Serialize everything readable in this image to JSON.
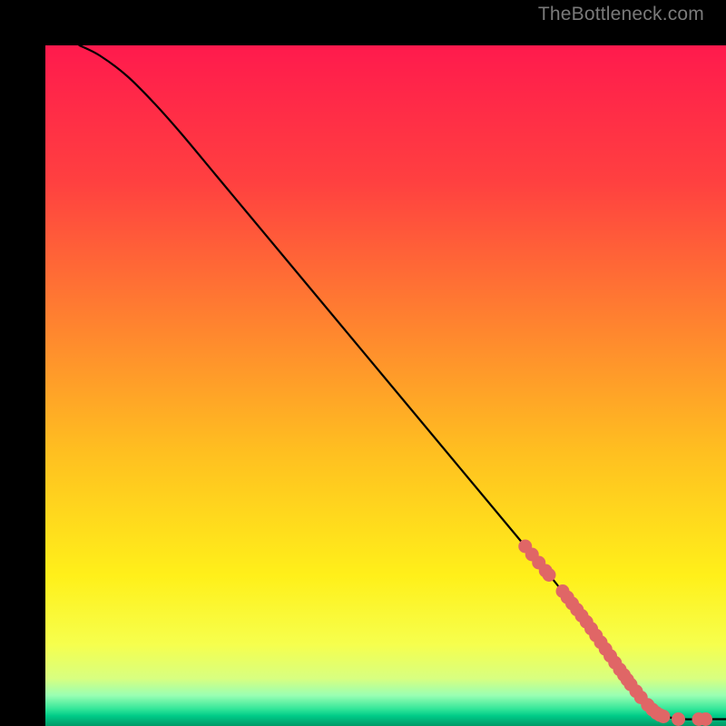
{
  "watermark": "TheBottleneck.com",
  "chart_data": {
    "type": "line",
    "title": "",
    "xlabel": "",
    "ylabel": "",
    "xlim": [
      0,
      100
    ],
    "ylim": [
      0,
      100
    ],
    "grid": false,
    "curve": {
      "x": [
        5,
        8,
        12,
        16,
        20,
        25,
        30,
        35,
        40,
        45,
        50,
        55,
        60,
        65,
        70,
        75,
        78,
        80,
        82,
        84,
        86,
        88,
        90,
        92,
        94,
        96,
        98,
        100
      ],
      "y": [
        100,
        98.5,
        95.5,
        91.5,
        87,
        81,
        75,
        69,
        63,
        57,
        51,
        45,
        39,
        33,
        27,
        21,
        17,
        14,
        11,
        8,
        5.5,
        3.5,
        2,
        1.2,
        1,
        1,
        1,
        1
      ]
    },
    "highlight_points": {
      "color": "#e06666",
      "x": [
        70.5,
        71.5,
        72.5,
        73.5,
        74.0,
        76.0,
        76.7,
        77.4,
        78.1,
        78.8,
        79.5,
        80.2,
        80.9,
        81.6,
        82.3,
        83.0,
        83.7,
        84.4,
        85.0,
        85.5,
        86.0,
        86.8,
        87.5,
        88.5,
        89.2,
        89.8,
        90.3,
        90.8,
        93.0,
        96.0,
        97.0
      ],
      "y": [
        26.4,
        25.2,
        24.0,
        22.8,
        22.2,
        19.8,
        18.9,
        18.0,
        17.1,
        16.2,
        15.3,
        14.3,
        13.3,
        12.3,
        11.3,
        10.3,
        9.3,
        8.3,
        7.5,
        6.8,
        6.1,
        5.1,
        4.2,
        3.1,
        2.4,
        1.9,
        1.6,
        1.4,
        1.0,
        1.0,
        1.0
      ]
    },
    "background_gradient": {
      "type": "vertical",
      "stops": [
        {
          "pos": 0.0,
          "color": "#ff1a4d"
        },
        {
          "pos": 0.2,
          "color": "#ff4040"
        },
        {
          "pos": 0.4,
          "color": "#ff8030"
        },
        {
          "pos": 0.6,
          "color": "#ffc020"
        },
        {
          "pos": 0.78,
          "color": "#fff01a"
        },
        {
          "pos": 0.88,
          "color": "#f6ff4d"
        },
        {
          "pos": 0.93,
          "color": "#d8ff80"
        },
        {
          "pos": 0.955,
          "color": "#99ffb3"
        },
        {
          "pos": 0.975,
          "color": "#33e699"
        },
        {
          "pos": 0.985,
          "color": "#00cc88"
        },
        {
          "pos": 1.0,
          "color": "#009966"
        }
      ]
    }
  }
}
